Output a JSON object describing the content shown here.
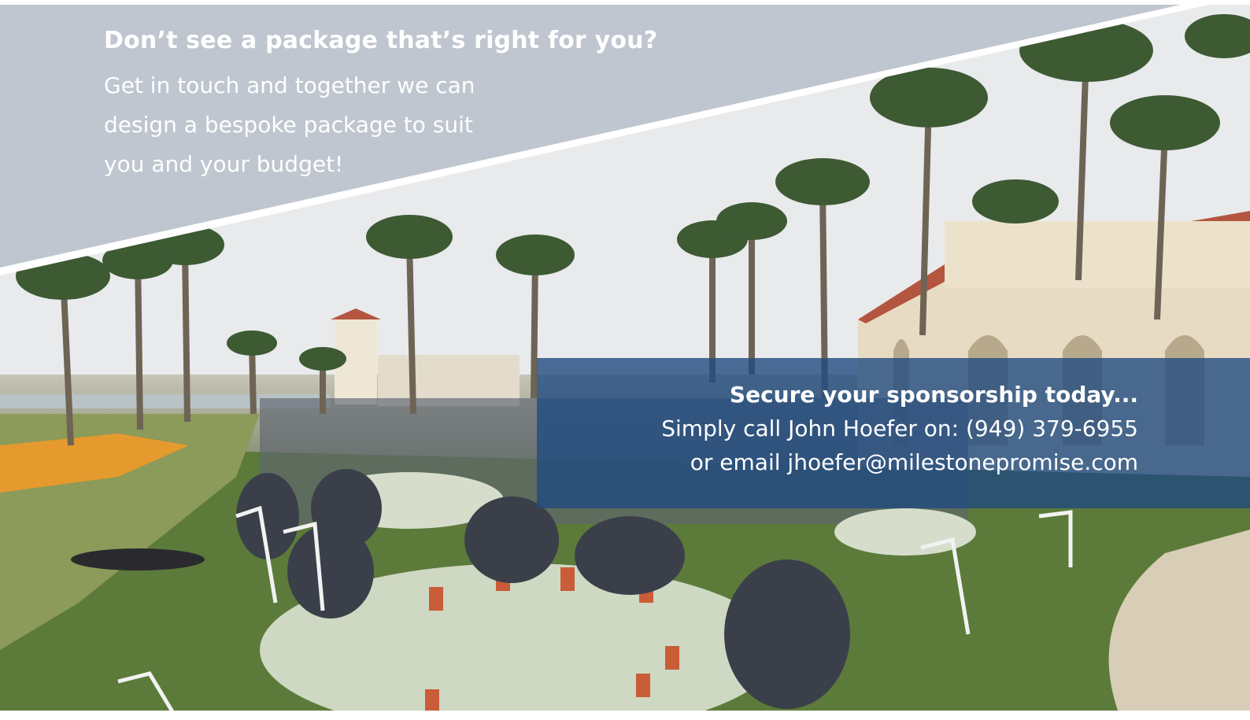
{
  "promo": {
    "headline": "Don’t see a package that’s right for you?",
    "body_lines": [
      "Get in touch and together we can",
      "design a bespoke package to suit",
      "you and your budget!"
    ]
  },
  "cta": {
    "title": "Secure your sponsorship today...",
    "phone_line": "Simply call John Hoefer on:  (949) 379-6955",
    "email_line": "or email jhoefer@milestonepromise.com"
  },
  "colors": {
    "band": "#bfc6cf",
    "cta_panel": "#214b80",
    "text": "#ffffff"
  }
}
